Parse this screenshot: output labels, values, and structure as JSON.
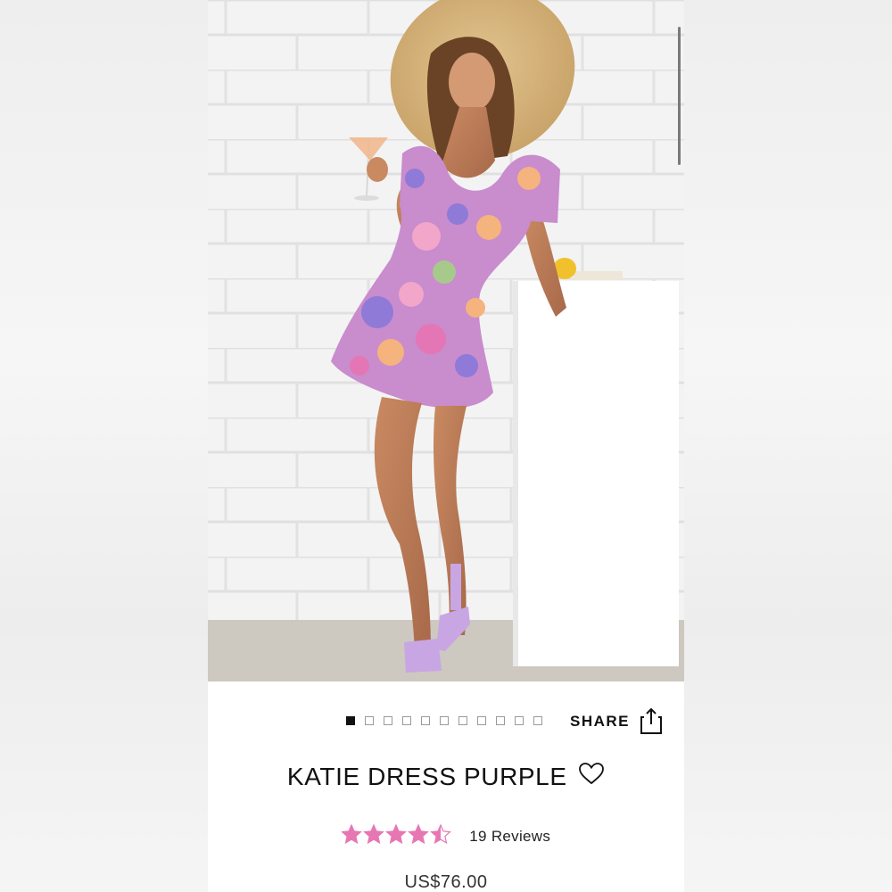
{
  "gallery": {
    "image_count": 11,
    "active_index": 0
  },
  "share": {
    "label": "SHARE",
    "icon": "share-icon"
  },
  "product": {
    "title": "KATIE DRESS PURPLE",
    "favorite_icon": "heart-outline-icon",
    "rating": 4.5,
    "rating_max": 5,
    "reviews_label": "19 Reviews",
    "price": "US$76.00"
  },
  "colors": {
    "star": "#e777b3",
    "text": "#111111",
    "dot_active": "#111111"
  }
}
